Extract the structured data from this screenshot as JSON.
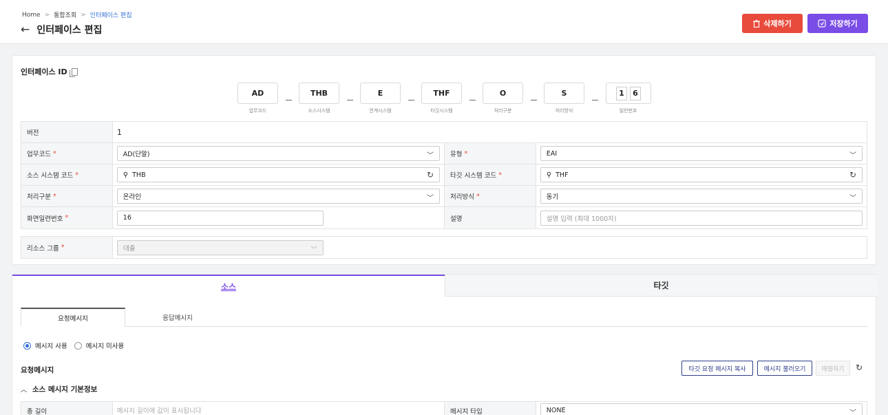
{
  "breadcrumb": {
    "home": "Home",
    "sep": ">",
    "parent": "통합조회",
    "current": "인터페이스 편집"
  },
  "header": {
    "back_icon": "←",
    "title": "인터페이스 편집",
    "delete_label": "삭제하기",
    "save_label": "저장하기"
  },
  "colors": {
    "delete": "#e84b3c",
    "save": "#7a4de6",
    "link": "#2f6fd6"
  },
  "interface_id": {
    "label": "인터페이스 ID",
    "segments": [
      {
        "value": "AD",
        "caption": "업무코드"
      },
      {
        "value": "THB",
        "caption": "소스시스템"
      },
      {
        "value": "E",
        "caption": "연계시스템"
      },
      {
        "value": "THF",
        "caption": "타깃시스템"
      },
      {
        "value": "O",
        "caption": "처리구분"
      },
      {
        "value": "S",
        "caption": "처리방식"
      }
    ],
    "serial": {
      "digits": [
        "1",
        "6"
      ],
      "caption": "일련번호"
    }
  },
  "form": {
    "version": {
      "label": "버전",
      "value": "1"
    },
    "biz_code": {
      "label": "업무코드",
      "value": "AD(단말)"
    },
    "type": {
      "label": "유형",
      "value": "EAI"
    },
    "source_code": {
      "label": "소스 시스템 코드",
      "value": "THB"
    },
    "target_code": {
      "label": "타깃 시스템 코드",
      "value": "THF"
    },
    "proc_div": {
      "label": "처리구분",
      "value": "온라인"
    },
    "proc_method": {
      "label": "처리방식",
      "value": "동기"
    },
    "screen_serial": {
      "label": "화면일련번호",
      "value": "16"
    },
    "desc": {
      "label": "설명",
      "placeholder": "설명 입력 (최대 1000자)"
    },
    "resource_group": {
      "label": "리소스 그룹",
      "value": "대출"
    },
    "required_mark": "*"
  },
  "tabs": {
    "source": "소스",
    "target": "타깃"
  },
  "subtabs": {
    "request": "요청메시지",
    "response": "응답메시지"
  },
  "radios": {
    "use": "메시지 사용",
    "unused": "메시지 미사용"
  },
  "request_section": {
    "title": "요청메시지",
    "btn_copy": "타깃 요청 메시지 복사",
    "btn_load": "메시지 불러오기",
    "btn_map": "매핑하기"
  },
  "source_basic": {
    "title": "소스 메시지 기본정보",
    "total_length_label": "총 길이",
    "total_length_placeholder": "메시지 길이에 값이 표시됩니다",
    "msg_type_label": "메시지 타입",
    "msg_type_value": "NONE"
  }
}
